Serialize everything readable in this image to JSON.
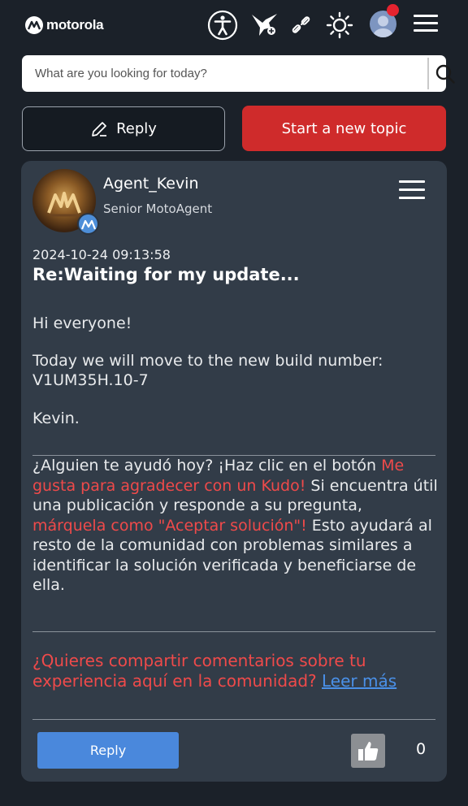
{
  "header": {
    "brand": "motorola",
    "icons": [
      "accessibility-icon",
      "hummingbird-icon",
      "link-icon",
      "brightness-icon",
      "user-avatar-icon",
      "menu-icon"
    ]
  },
  "search": {
    "placeholder": "What are you looking for today?"
  },
  "actions": {
    "reply_label": "Reply",
    "new_topic_label": "Start a new topic"
  },
  "post": {
    "author": "Agent_Kevin",
    "rank": "Senior MotoAgent",
    "date": "2024-10-24 09:13:58",
    "title": "Re:Waiting for my update...",
    "greeting": "Hi everyone!",
    "message_line1": "Today we will move to the new build number:",
    "message_line2": "V1UM35H.10-7",
    "signoff": "Kevin.",
    "signature": {
      "s1": "¿Alguien te ayudó hoy? ¡Haz clic en el botón ",
      "s2_red": "Me gusta para agradecer con un Kudo!",
      "s3": " Si encuentra útil una publicación y responde a su pregunta, ",
      "s4_red": "márquela como \"Aceptar solución\"!",
      "s5": " Esto ayudará al resto de la comunidad con problemas similares a identificar la solución verificada y beneficiarse de ella."
    },
    "feedback_text": "¿Quieres compartir comentarios sobre tu experiencia aquí en la comunidad? ",
    "feedback_link": "Leer más",
    "reply_label": "Reply",
    "kudos_count": "0"
  },
  "colors": {
    "background": "#1b2129",
    "card": "#323c48",
    "accent_red": "#cf2b2b",
    "reply_blue": "#4a88dc",
    "link_blue": "#4a90e8"
  }
}
